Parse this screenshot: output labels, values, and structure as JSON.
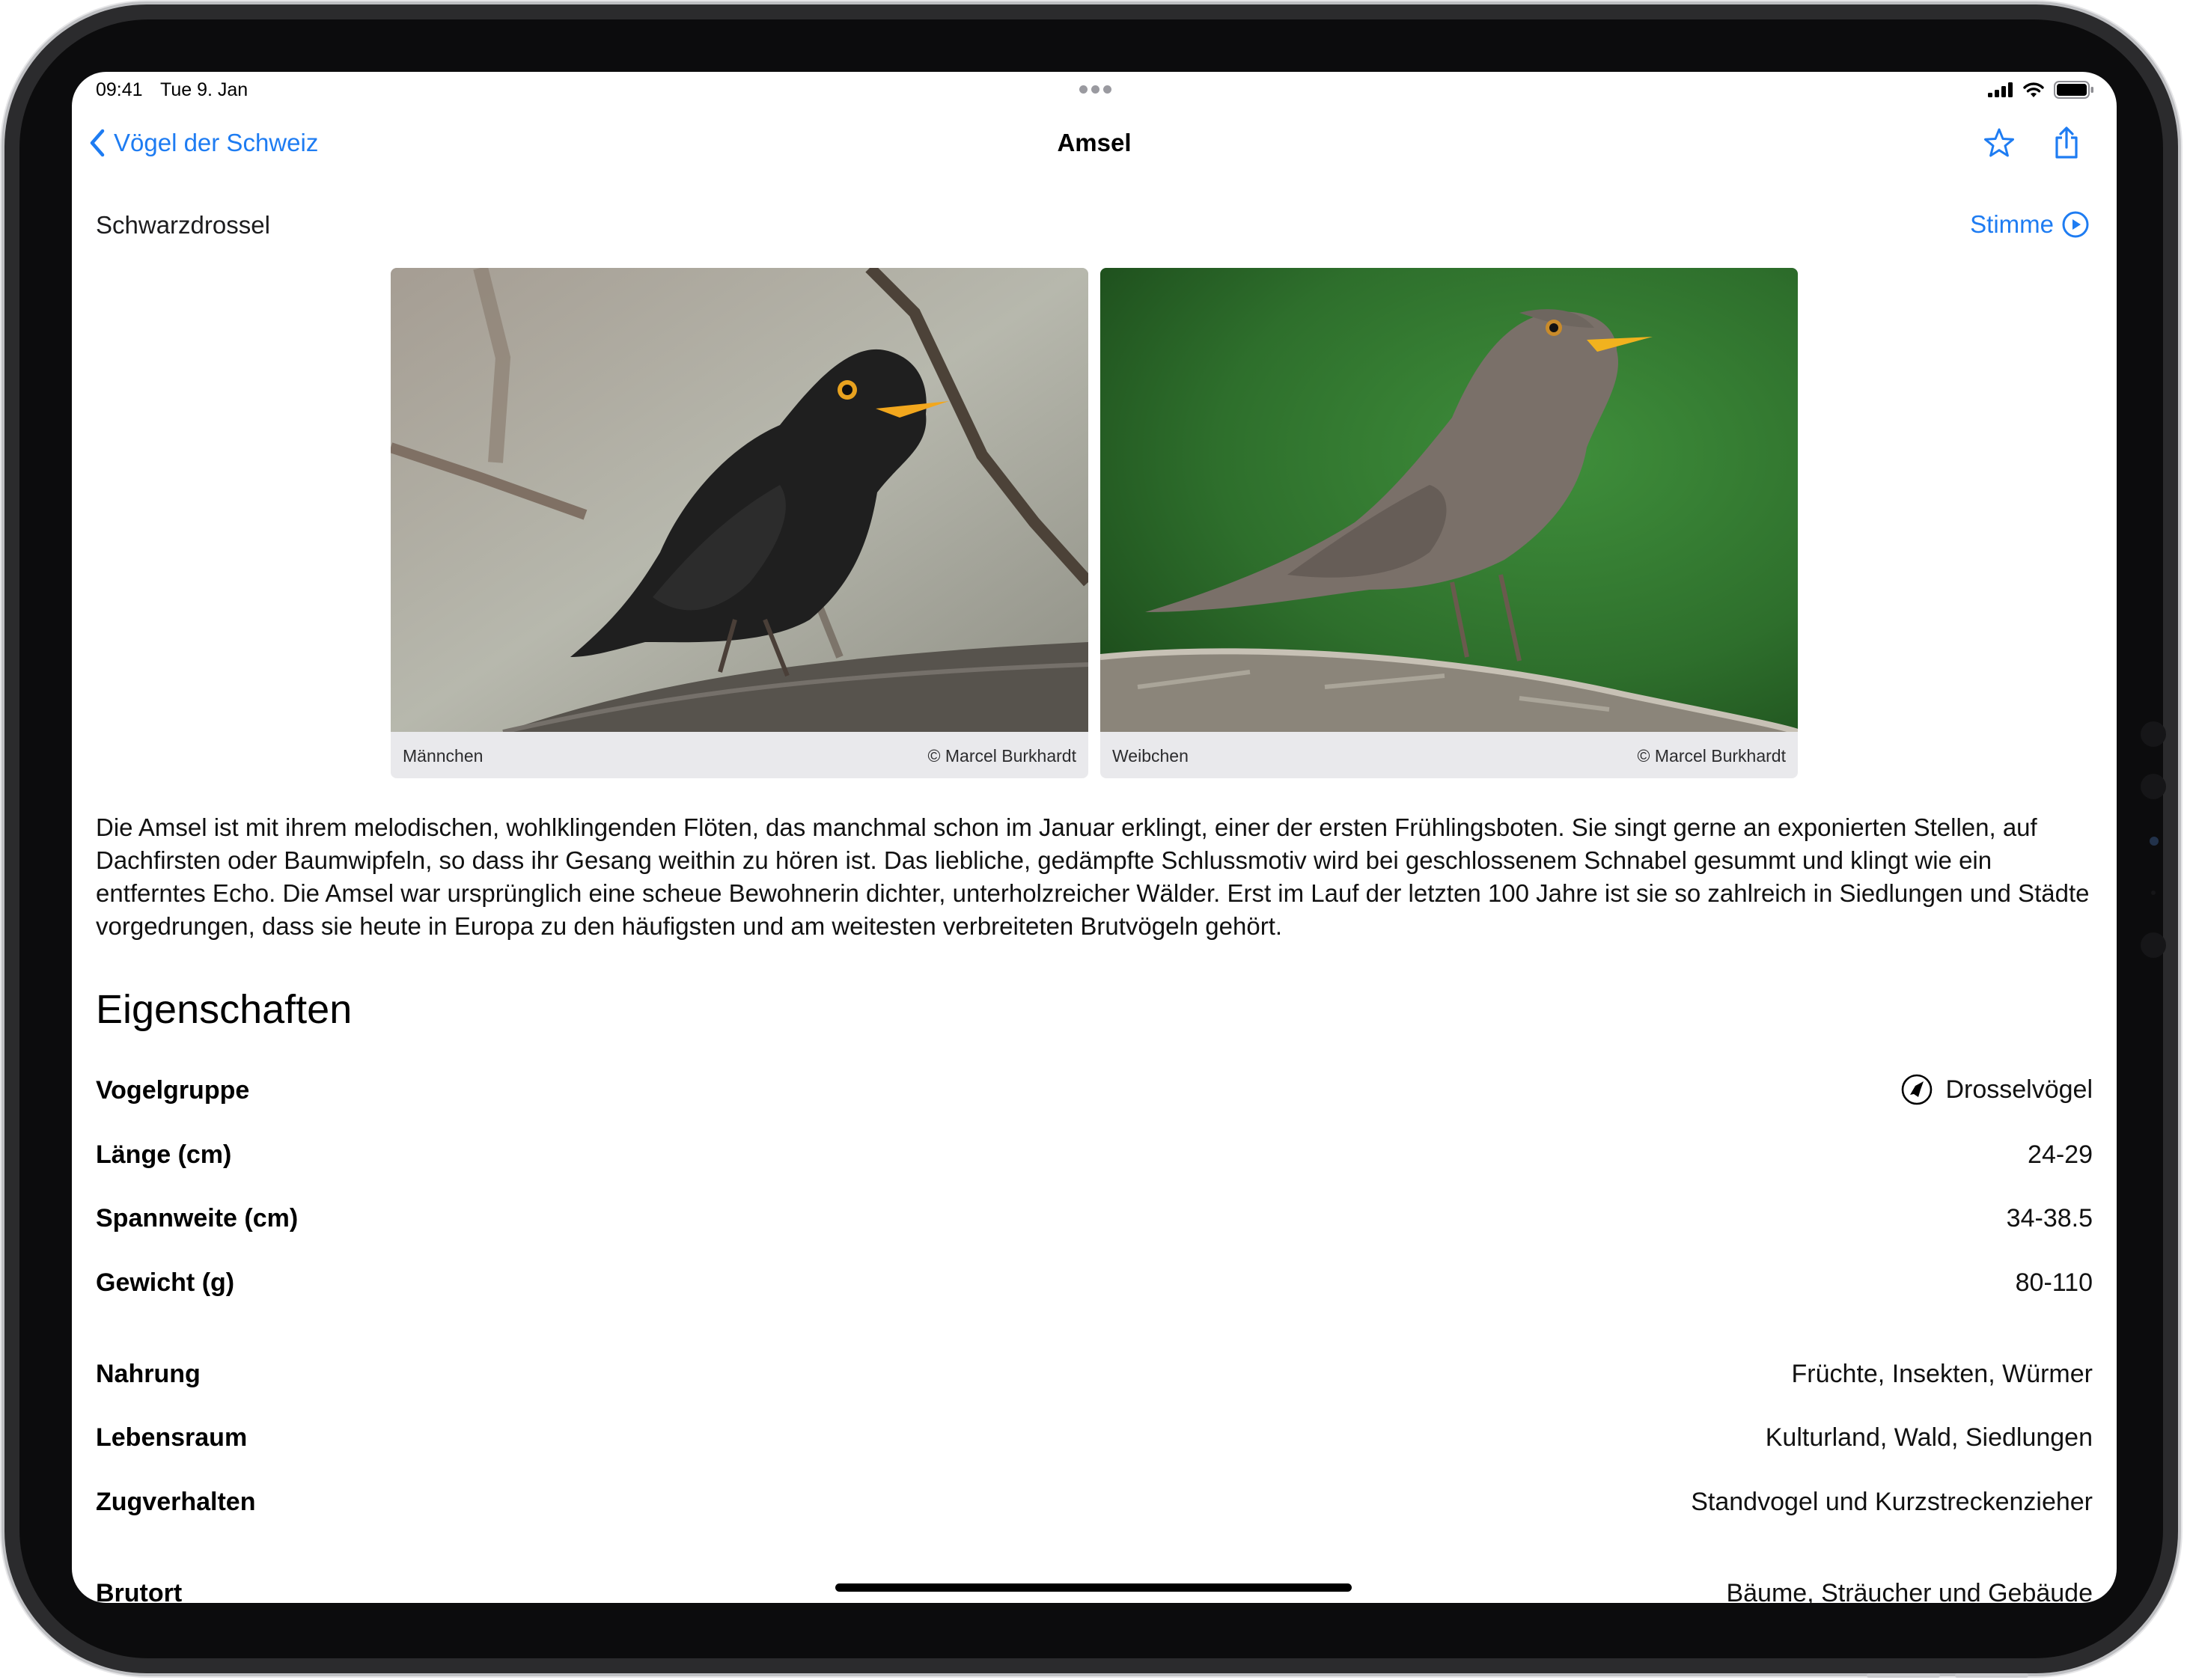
{
  "status_bar": {
    "time": "09:41",
    "date": "Tue 9. Jan"
  },
  "nav": {
    "back_label": "Vögel der Schweiz",
    "title": "Amsel",
    "icons": [
      "chevron-left-icon",
      "star-icon",
      "share-icon"
    ]
  },
  "species": {
    "subtitle": "Schwarzdrossel",
    "voice_label": "Stimme"
  },
  "photos": [
    {
      "caption": "Männchen",
      "credit": "© Marcel Burkhardt"
    },
    {
      "caption": "Weibchen",
      "credit": "© Marcel Burkhardt"
    }
  ],
  "description": "Die Amsel ist mit ihrem melodischen, wohlklingenden Flöten, das manchmal schon im Januar erklingt, einer der ersten Frühlingsboten. Sie singt gerne an exponierten Stellen, auf Dachfirsten oder Baumwipfeln, so dass ihr Gesang weithin zu hören ist. Das liebliche, gedämpfte Schlussmotiv wird bei geschlossenem Schnabel gesummt und klingt wie ein entferntes Echo. Die Amsel war ursprünglich eine scheue Bewohnerin dichter, unterholzreicher Wälder. Erst im Lauf der letzten 100 Jahre ist sie so zahlreich in Siedlungen und Städte vorgedrungen, dass sie heute in Europa zu den häufigsten und am weitesten verbreiteten Brutvögeln gehört.",
  "properties": {
    "section_title": "Eigenschaften",
    "rows": [
      {
        "label": "Vogelgruppe",
        "value": "Drosselvögel",
        "icon": "bird-group-icon"
      },
      {
        "label": "Länge (cm)",
        "value": "24-29"
      },
      {
        "label": "Spannweite (cm)",
        "value": "34-38.5"
      },
      {
        "label": "Gewicht (g)",
        "value": "80-110"
      },
      {
        "label": "Nahrung",
        "value": "Früchte, Insekten, Würmer"
      },
      {
        "label": "Lebensraum",
        "value": "Kulturland, Wald, Siedlungen"
      },
      {
        "label": "Zugverhalten",
        "value": "Standvogel und Kurzstreckenzieher"
      },
      {
        "label": "Brutort",
        "value": "Bäume, Sträucher und Gebäude"
      }
    ]
  },
  "colors": {
    "accent": "#1e7cf2",
    "caption_bg": "#e9e9ec"
  }
}
